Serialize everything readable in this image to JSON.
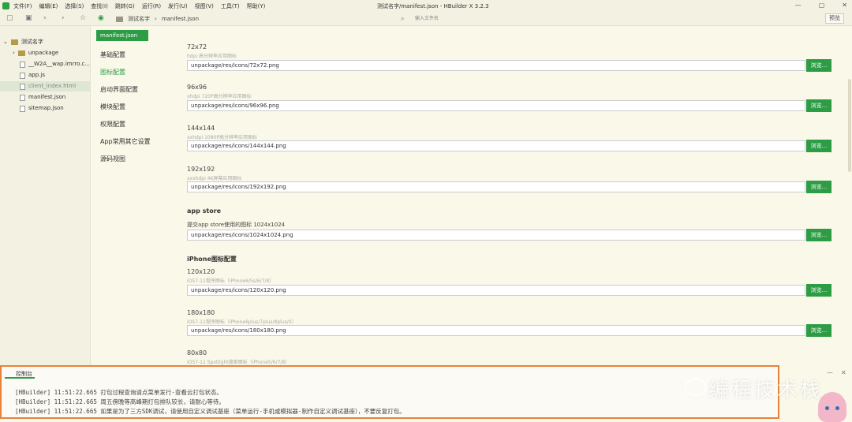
{
  "menubar": {
    "items": [
      "文件(F)",
      "编辑(E)",
      "选择(S)",
      "查找(I)",
      "跳转(G)",
      "运行(R)",
      "发行(U)",
      "视图(V)",
      "工具(T)",
      "帮助(Y)"
    ],
    "window_title": "测试名字/manifest.json - HBuilder X 3.2.3"
  },
  "toolbar": {
    "breadcrumb": [
      "测试名字",
      "manifest.json"
    ],
    "search_placeholder": "输入文件名",
    "preview_label": "预览"
  },
  "explorer": {
    "project": "测试名字",
    "items": [
      {
        "label": "unpackage",
        "type": "folder"
      },
      {
        "label": "__W2A__wap.imrro.c...",
        "type": "file"
      },
      {
        "label": "app.js",
        "type": "file"
      },
      {
        "label": "client_index.html",
        "type": "file",
        "selected": true
      },
      {
        "label": "manifest.json",
        "type": "file"
      },
      {
        "label": "sitemap.json",
        "type": "file"
      }
    ]
  },
  "settings_nav": {
    "tab": "manifest.json",
    "items": [
      "基础配置",
      "图标配置",
      "启动界面配置",
      "模块配置",
      "权限配置",
      "App常用其它设置",
      "源码视图"
    ],
    "active_index": 1
  },
  "content": {
    "top_title": "72x72",
    "top_desc": "hdpi 高分辨率应用图标",
    "browse_label": "浏览...",
    "fields": [
      {
        "value": "unpackage/res/icons/72x72.png"
      },
      {
        "title": "96x96",
        "desc": "xhdpi 720P高分辨率应用图标",
        "value": "unpackage/res/icons/96x96.png"
      },
      {
        "title": "144x144",
        "desc": "xxhdpi 1080P高分辨率应用图标",
        "value": "unpackage/res/icons/144x144.png"
      },
      {
        "title": "192x192",
        "desc": "xxxhdpi 4K屏幕应用图标",
        "value": "unpackage/res/icons/192x192.png"
      },
      {
        "title": "提交app store使用的图标 1024x1024",
        "value": "unpackage/res/icons/1024x1024.png"
      },
      {
        "title": "120x120",
        "desc": "iOS7-11程序图标（iPhone6/5s/6/7/8）",
        "value": "unpackage/res/icons/120x120.png"
      },
      {
        "title": "180x180",
        "desc": "iOS7-11程序图标（iPhone6plus/7plus/8plus/X）",
        "value": "unpackage/res/icons/180x180.png"
      },
      {
        "title": "80x80",
        "desc": "iOS7-11 Spotlight搜索图标（iPhone5/6/7/8）"
      }
    ],
    "sections": [
      "app store",
      "iPhone图标配置"
    ]
  },
  "console": {
    "tab": "控制台",
    "lines": [
      "[HBuilder] 11:51:22.665 打包过程查询请点菜单发行-查看云打包状态。",
      "[HBuilder] 11:51:22.665 周五傍晚等高峰期打包排队较长，请耐心等待。",
      "[HBuilder] 11:51:22.665 如果是为了三方SDK调试，请使用自定义调试基座（菜单运行-手机或模拟器-制作自定义调试基座），不要反复打包。"
    ]
  },
  "watermark": {
    "text": "编程技术栈"
  },
  "colors": {
    "accent": "#2c9c45",
    "background": "#faf8e9",
    "console_border": "#e9823a"
  }
}
